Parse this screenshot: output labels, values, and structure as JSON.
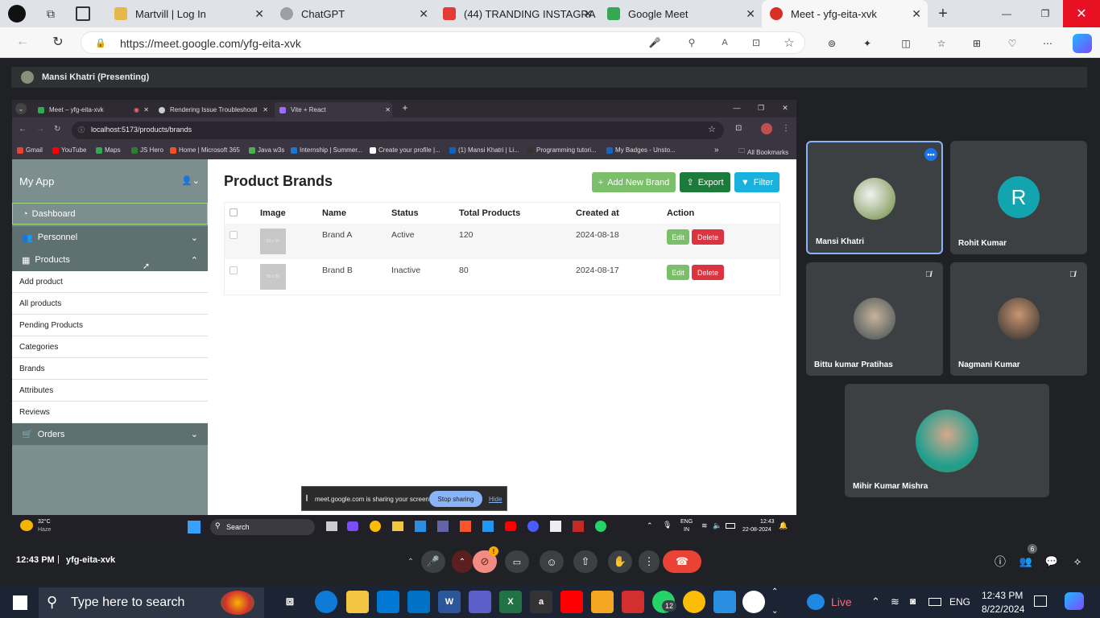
{
  "edge": {
    "tabs": [
      {
        "title": "Martvill | Log In",
        "color": "#e6b84b"
      },
      {
        "title": "ChatGPT",
        "color": "#9aa0a6"
      },
      {
        "title": "(44) TRANDING INSTAGRA",
        "color": "#e53935"
      },
      {
        "title": "Google Meet",
        "color": "#34a853"
      },
      {
        "title": "Meet - yfg-eita-xvk",
        "color": "#d93025"
      }
    ],
    "url": "https://meet.google.com/yfg-eita-xvk"
  },
  "presenter": {
    "label": "Mansi Khatri (Presenting)"
  },
  "shared": {
    "tabs": [
      {
        "title": "Meet – yfg-eita-xvk"
      },
      {
        "title": "Rendering Issue Troubleshooti"
      },
      {
        "title": "Vite + React"
      }
    ],
    "url": "localhost:5173/products/brands",
    "bookmarks": [
      {
        "label": "Gmail",
        "color": "#ea4335"
      },
      {
        "label": "YouTube",
        "color": "#ff0000"
      },
      {
        "label": "Maps",
        "color": "#34a853"
      },
      {
        "label": "JS Hero",
        "color": "#2e7d32"
      },
      {
        "label": "Home | Microsoft 365",
        "color": "#f25022"
      },
      {
        "label": "Java w3s",
        "color": "#4caf50"
      },
      {
        "label": "Internship | Summer...",
        "color": "#1976d2"
      },
      {
        "label": "Create your profile |...",
        "color": "#fff"
      },
      {
        "label": "(1) Mansi Khatri | Li...",
        "color": "#0a66c2"
      },
      {
        "label": "Programming tutori...",
        "color": "#333"
      },
      {
        "label": "My Badges - Unsto...",
        "color": "#1565c0"
      }
    ],
    "all_bookmarks": "All Bookmarks",
    "app": {
      "title": "My App",
      "nav": {
        "dashboard": "Dashboard",
        "personnel": "Personnel",
        "products": "Products",
        "orders": "Orders"
      },
      "submenu": [
        "Add product",
        "All products",
        "Pending Products",
        "Categories",
        "Brands",
        "Attributes",
        "Reviews"
      ],
      "page_title": "Product Brands",
      "buttons": {
        "add": "Add New Brand",
        "export": "Export",
        "filter": "Filter"
      },
      "columns": [
        "Image",
        "Name",
        "Status",
        "Total Products",
        "Created at",
        "Action"
      ],
      "rows": [
        {
          "img": "50 x 50",
          "name": "Brand A",
          "status": "Active",
          "total": "120",
          "created": "2024-08-18"
        },
        {
          "img": "50 x 50",
          "name": "Brand B",
          "status": "Inactive",
          "total": "80",
          "created": "2024-08-17"
        }
      ],
      "edit": "Edit",
      "delete": "Delete"
    },
    "share_bar": {
      "text": "meet.google.com is sharing your screen.",
      "stop": "Stop sharing",
      "hide": "Hide"
    },
    "taskbar": {
      "temp": "32°C",
      "weather": "Haze",
      "search": "Search",
      "lang1": "ENG",
      "lang2": "IN",
      "time": "12:43",
      "date": "22-08-2024"
    }
  },
  "participants": [
    {
      "name": "Mansi Khatri"
    },
    {
      "name": "Rohit Kumar",
      "initial": "R"
    },
    {
      "name": "Bittu kumar Pratihas"
    },
    {
      "name": "Nagmani Kumar"
    },
    {
      "name": "Mihir Kumar Mishra"
    }
  ],
  "meeting": {
    "time": "12:43 PM",
    "code": "yfg-eita-xvk",
    "people_count": "6",
    "notify_count": "!"
  },
  "os_taskbar": {
    "search": "Type here to search",
    "live": "Live",
    "lang": "ENG",
    "time": "12:43 PM",
    "date": "8/22/2024",
    "badge": "12"
  }
}
